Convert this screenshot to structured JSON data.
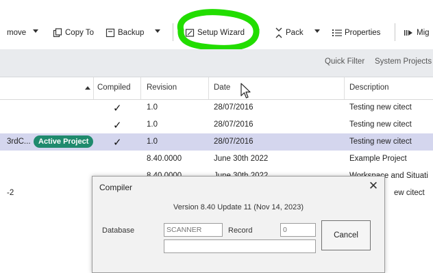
{
  "toolbar": {
    "remove_label": "move",
    "copy_to_label": "Copy To",
    "backup_label": "Backup",
    "setup_wizard_label": "Setup Wizard",
    "pack_label": "Pack",
    "properties_label": "Properties",
    "migrate_label": "Mig"
  },
  "filter_bar": {
    "quick_filter": "Quick Filter",
    "system_projects": "System Projects"
  },
  "table": {
    "headers": {
      "compiled": "Compiled",
      "revision": "Revision",
      "date": "Date",
      "description": "Description"
    },
    "rows": [
      {
        "name": "",
        "badge": "",
        "compiled": "✓",
        "revision": "1.0",
        "date": "28/07/2016",
        "description": "Testing new citect"
      },
      {
        "name": "",
        "badge": "",
        "compiled": "✓",
        "revision": "1.0",
        "date": "28/07/2016",
        "description": "Testing new citect"
      },
      {
        "name": "3rdC...",
        "badge": "Active Project",
        "compiled": "✓",
        "revision": "1.0",
        "date": "28/07/2016",
        "description": "Testing new citect"
      },
      {
        "name": "",
        "badge": "",
        "compiled": "",
        "revision": "8.40.0000",
        "date": "June 30th 2022",
        "description": "Example Project"
      },
      {
        "name": "",
        "badge": "",
        "compiled": "",
        "revision": "8.40.0000",
        "date": "June 30th 2022",
        "description": "Workspace and Situati"
      },
      {
        "name": "-2",
        "badge": "",
        "compiled": "",
        "revision": "",
        "date": "",
        "description": "ew citect"
      }
    ]
  },
  "dialog": {
    "title": "Compiler",
    "close": "✕",
    "version": "Version 8.40 Update 11 (Nov 14, 2023)",
    "database_label": "Database",
    "database_value": "SCANNER",
    "record_label": "Record",
    "record_value": "0",
    "cancel_label": "Cancel"
  },
  "colors": {
    "highlight": "#22dd00",
    "badge": "#1f8a6d",
    "selected_row": "#d4d6ee",
    "filter_bar": "#e9ebee"
  }
}
